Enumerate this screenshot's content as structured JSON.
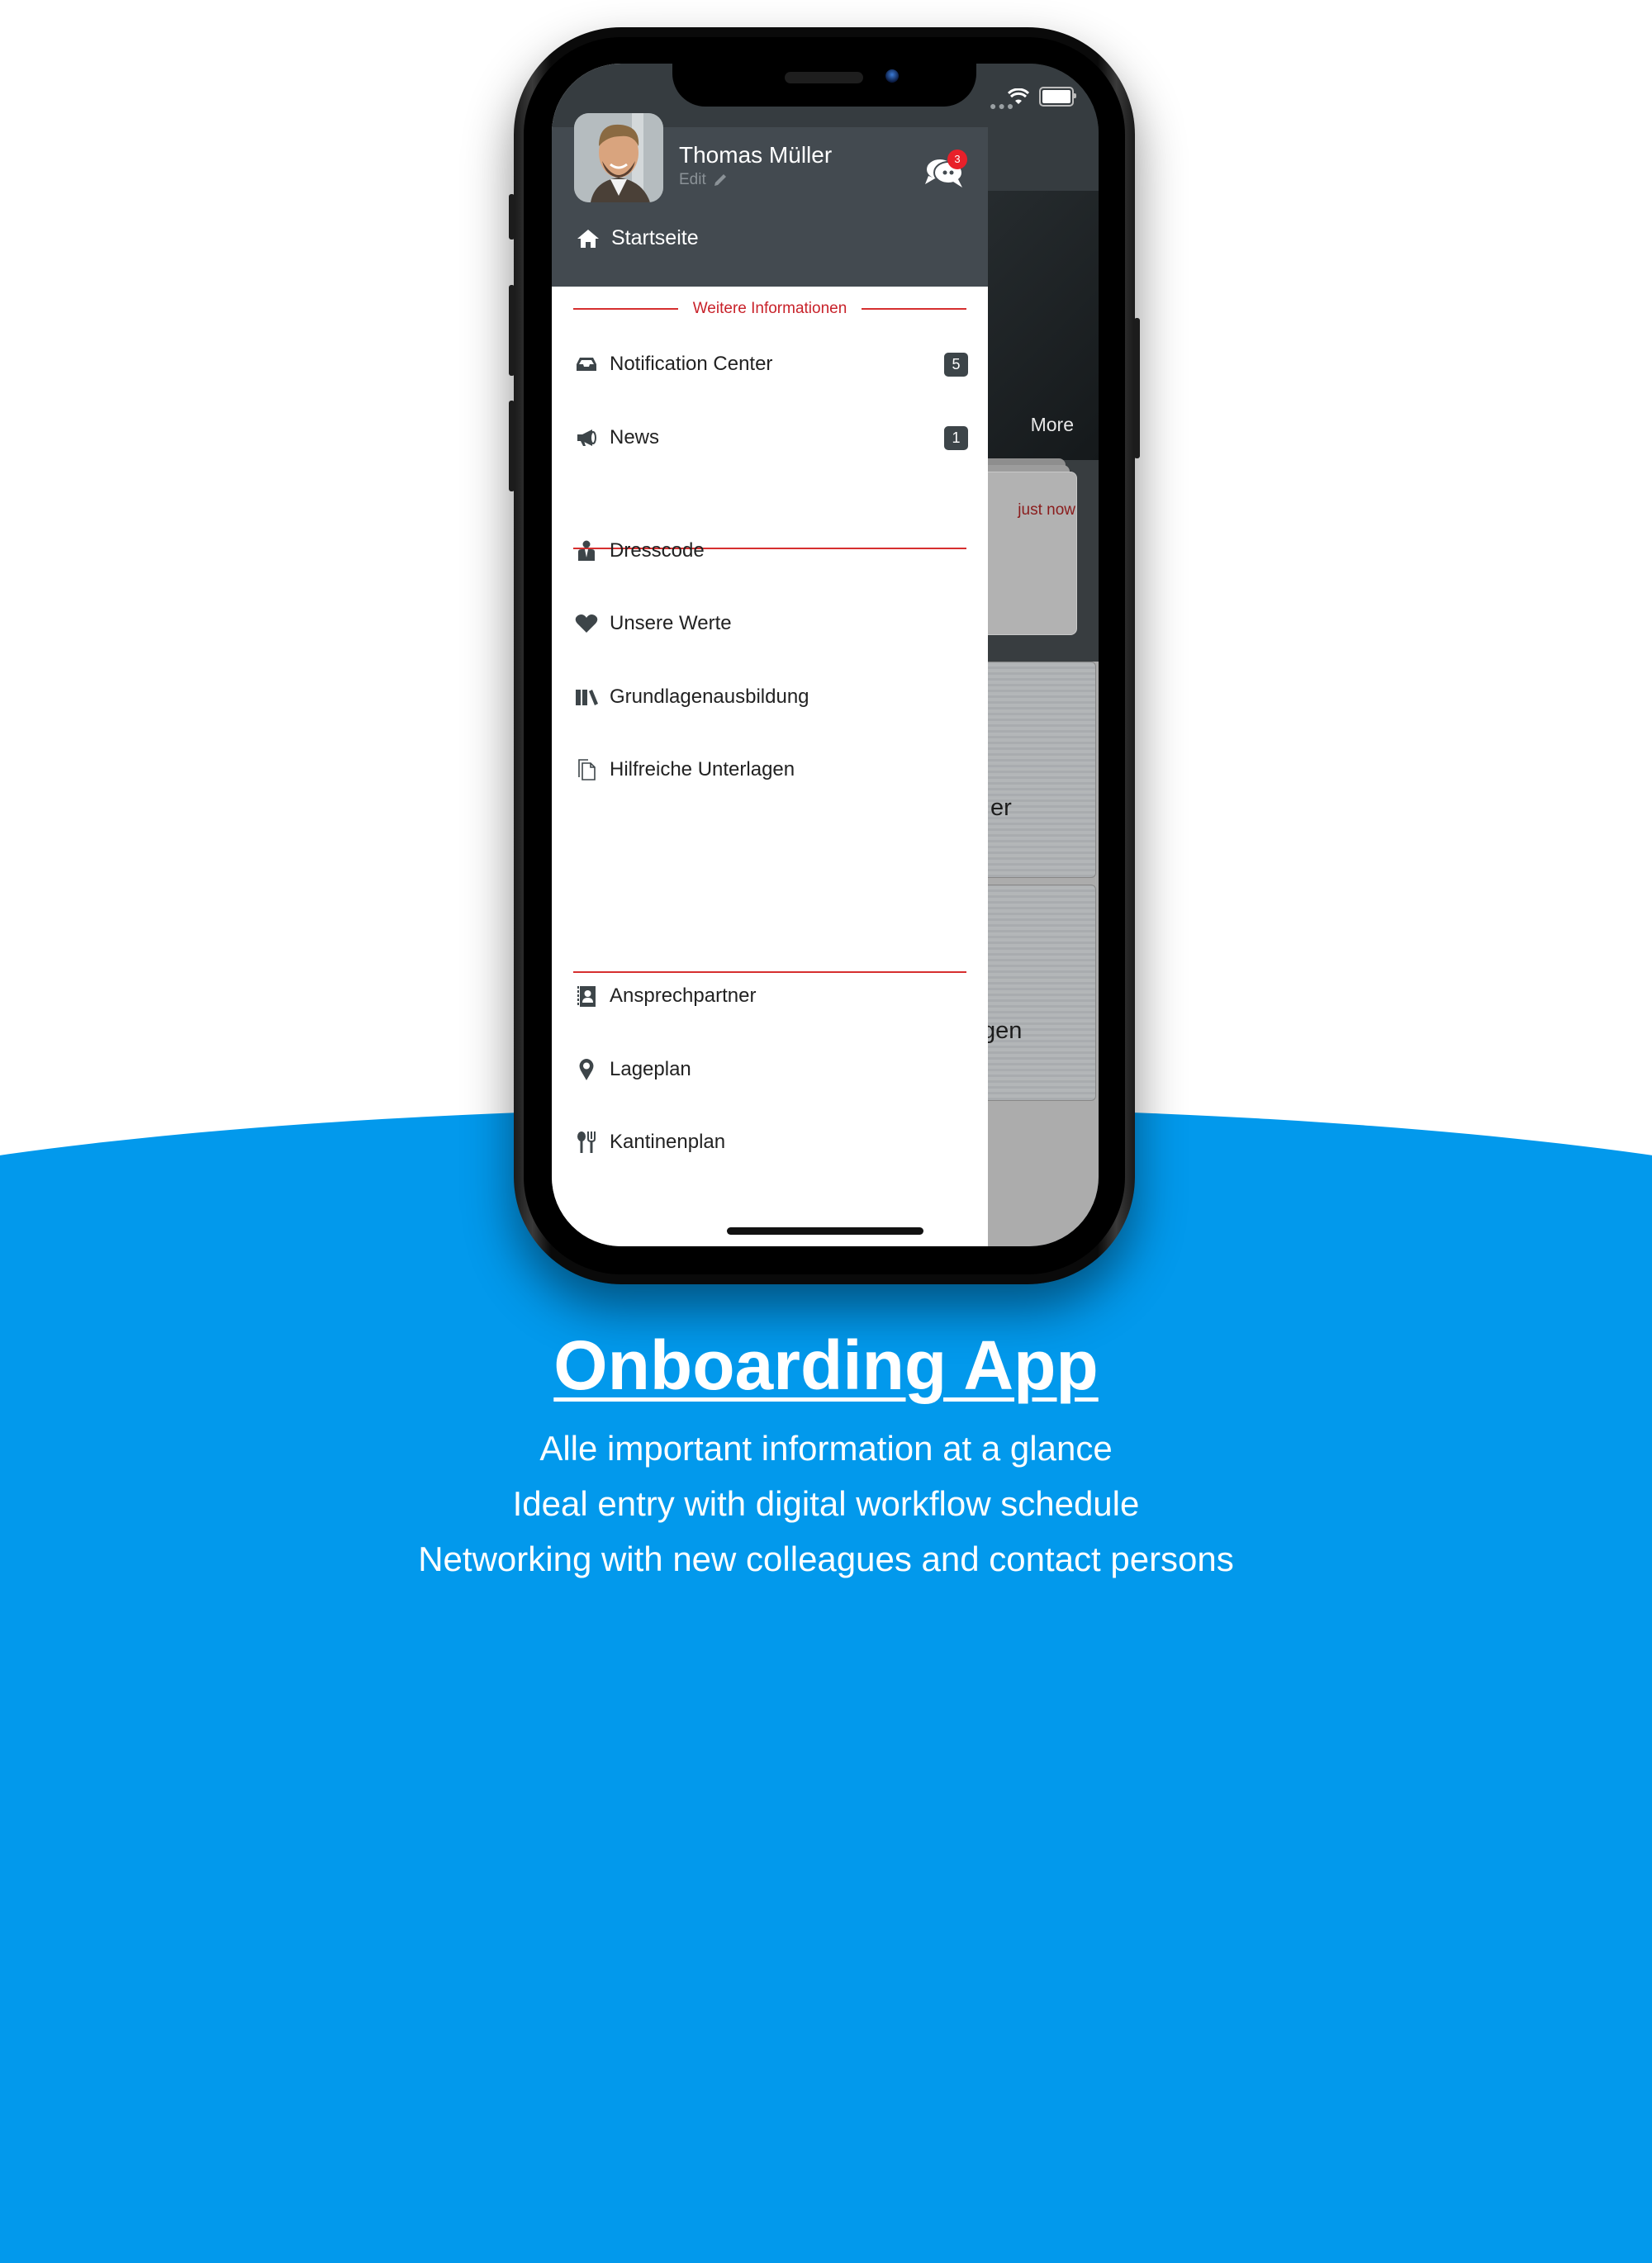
{
  "status_bar": {
    "wifi_icon": "wifi-icon",
    "battery_icon": "battery-icon"
  },
  "background_app": {
    "more_label": "More",
    "card_time": "just now",
    "tile1_partial": "er",
    "tile2_partial": "gen"
  },
  "drawer": {
    "profile": {
      "name": "Thomas Müller",
      "edit_label": "Edit",
      "chat_badge": "3"
    },
    "home": {
      "label": "Startseite",
      "icon": "home-icon"
    },
    "section_title": "Weitere Informationen",
    "items": [
      {
        "label": "Notification Center",
        "icon": "inbox-icon",
        "badge": "5"
      },
      {
        "label": "News",
        "icon": "megaphone-icon",
        "badge": "1"
      },
      {
        "label": "Dresscode",
        "icon": "user-tie-icon"
      },
      {
        "label": "Unsere Werte",
        "icon": "heart-icon"
      },
      {
        "label": "Grundlagenausbildung",
        "icon": "books-icon"
      },
      {
        "label": "Hilfreiche Unterlagen",
        "icon": "documents-icon"
      },
      {
        "label": "Ansprechpartner",
        "icon": "address-book-icon"
      },
      {
        "label": "Lageplan",
        "icon": "map-pin-icon"
      },
      {
        "label": "Kantinenplan",
        "icon": "utensils-icon"
      }
    ]
  },
  "marketing": {
    "headline": "Onboarding App",
    "lines": [
      "Alle important information at a glance",
      "Ideal entry with digital workflow schedule",
      "Networking with new colleagues and contact persons"
    ]
  },
  "colors": {
    "accent_red": "#c8222a",
    "background_blue": "#0299ec",
    "drawer_header": "#434a50"
  }
}
